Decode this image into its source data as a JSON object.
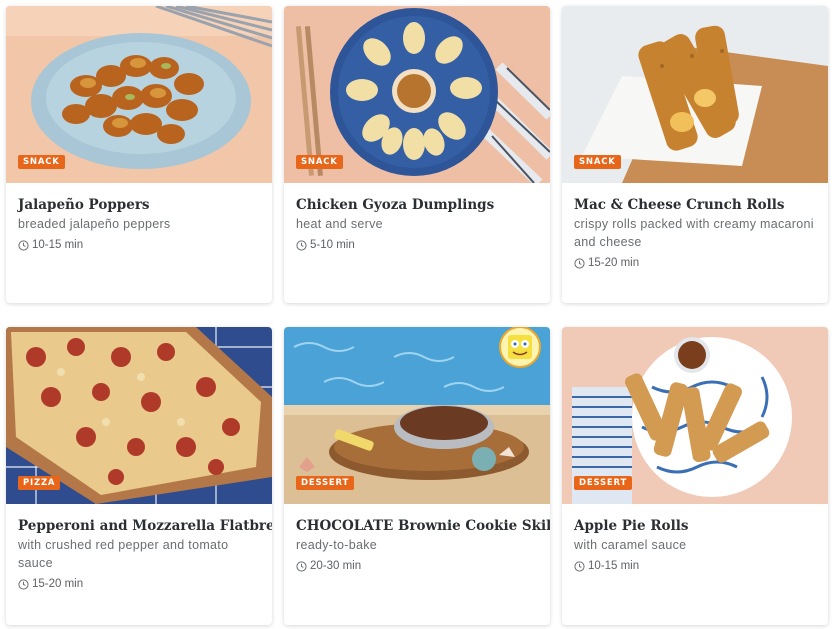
{
  "cards": [
    {
      "category": "SNACK",
      "title": "Jalapeño Poppers",
      "description": "breaded jalapeño peppers",
      "time": "10-15 min",
      "image_icon": "jalapeno-poppers-photo"
    },
    {
      "category": "SNACK",
      "title": "Chicken Gyoza Dumplings",
      "description": "heat and serve",
      "time": "5-10 min",
      "image_icon": "gyoza-dumplings-photo"
    },
    {
      "category": "SNACK",
      "title": "Mac & Cheese Crunch Rolls",
      "description": "crispy rolls packed with creamy macaroni and cheese",
      "time": "15-20 min",
      "image_icon": "mac-cheese-rolls-photo"
    },
    {
      "category": "PIZZA",
      "title": "Pepperoni and Mozzarella Flatbread",
      "description": "with crushed red pepper and tomato sauce",
      "time": "15-20 min",
      "image_icon": "flatbread-photo"
    },
    {
      "category": "DESSERT",
      "title": "CHOCOLATE Brownie Cookie Skillet",
      "description": "ready-to-bake",
      "time": "20-30 min",
      "image_icon": "brownie-skillet-photo"
    },
    {
      "category": "DESSERT",
      "title": "Apple Pie Rolls",
      "description": "with caramel sauce",
      "time": "10-15 min",
      "image_icon": "apple-pie-rolls-photo"
    }
  ],
  "colors": {
    "badge": "#e8661a",
    "title": "#2b2f33",
    "muted": "#6a6e72"
  }
}
